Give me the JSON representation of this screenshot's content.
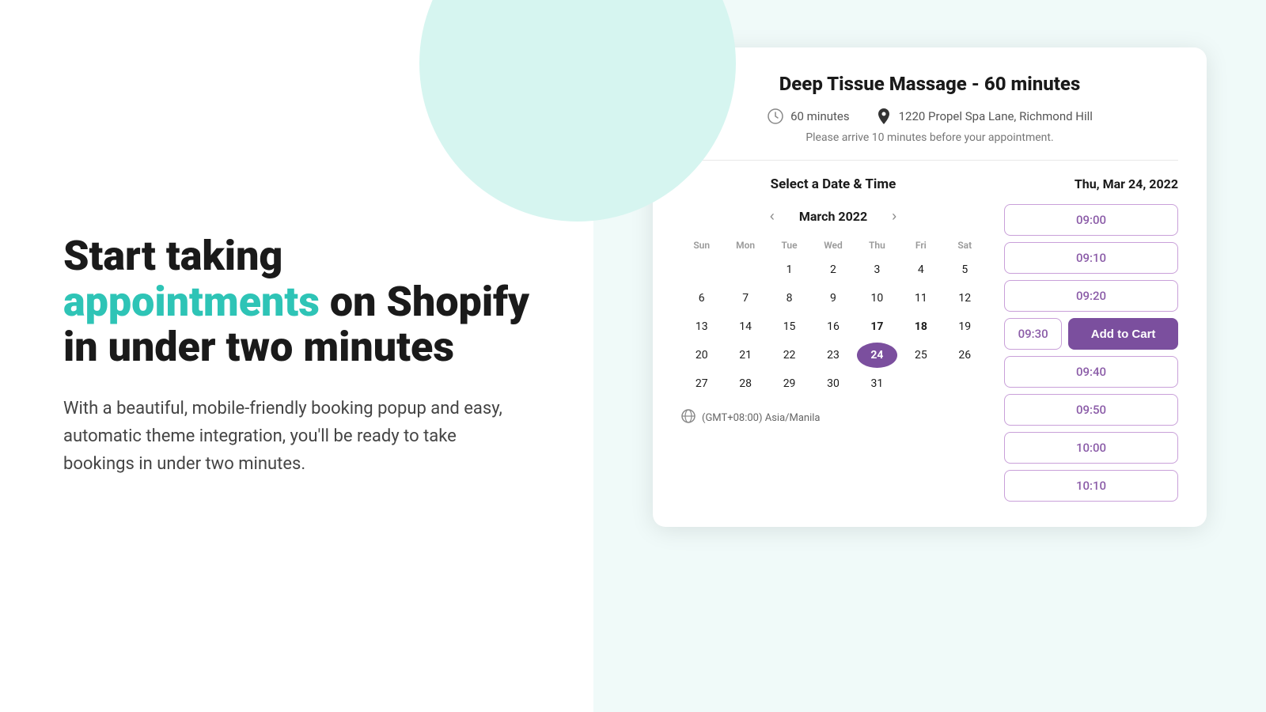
{
  "left": {
    "headline_start": "Start taking ",
    "headline_accent": "appointments",
    "headline_end": " on Shopify in under two minutes",
    "subtext": "With a beautiful, mobile-friendly booking popup and easy, automatic theme integration, you'll be ready to take bookings in under two minutes."
  },
  "card": {
    "title": "Deep Tissue Massage - 60 minutes",
    "meta": {
      "duration": "60 minutes",
      "location": "1220 Propel Spa Lane, Richmond Hill"
    },
    "arrival_note": "Please arrive 10 minutes before your appointment.",
    "calendar": {
      "section_heading": "Select a Date & Time",
      "month_label": "March 2022",
      "day_headers": [
        "Sun",
        "Mon",
        "Tue",
        "Wed",
        "Thu",
        "Fri",
        "Sat"
      ],
      "rows": [
        [
          "",
          "",
          "1",
          "2",
          "3",
          "4",
          "5"
        ],
        [
          "6",
          "7",
          "8",
          "9",
          "10",
          "11",
          "12"
        ],
        [
          "13",
          "14",
          "15",
          "16",
          "17",
          "18",
          "19"
        ],
        [
          "20",
          "21",
          "22",
          "23",
          "24",
          "25",
          "26"
        ],
        [
          "27",
          "28",
          "29",
          "30",
          "31",
          "",
          ""
        ]
      ],
      "selected_day": "24",
      "bold_days": [
        "17",
        "18"
      ],
      "timezone": "(GMT+08:00) Asia/Manila"
    },
    "times": {
      "date_label": "Thu, Mar 24, 2022",
      "slots": [
        {
          "time": "09:00",
          "type": "full"
        },
        {
          "time": "09:10",
          "type": "full"
        },
        {
          "time": "09:20",
          "type": "full"
        },
        {
          "time": "09:30",
          "type": "half",
          "add_to_cart": "Add to Cart"
        },
        {
          "time": "09:40",
          "type": "full"
        },
        {
          "time": "09:50",
          "type": "full"
        },
        {
          "time": "10:00",
          "type": "full"
        },
        {
          "time": "10:10",
          "type": "full"
        }
      ]
    }
  }
}
